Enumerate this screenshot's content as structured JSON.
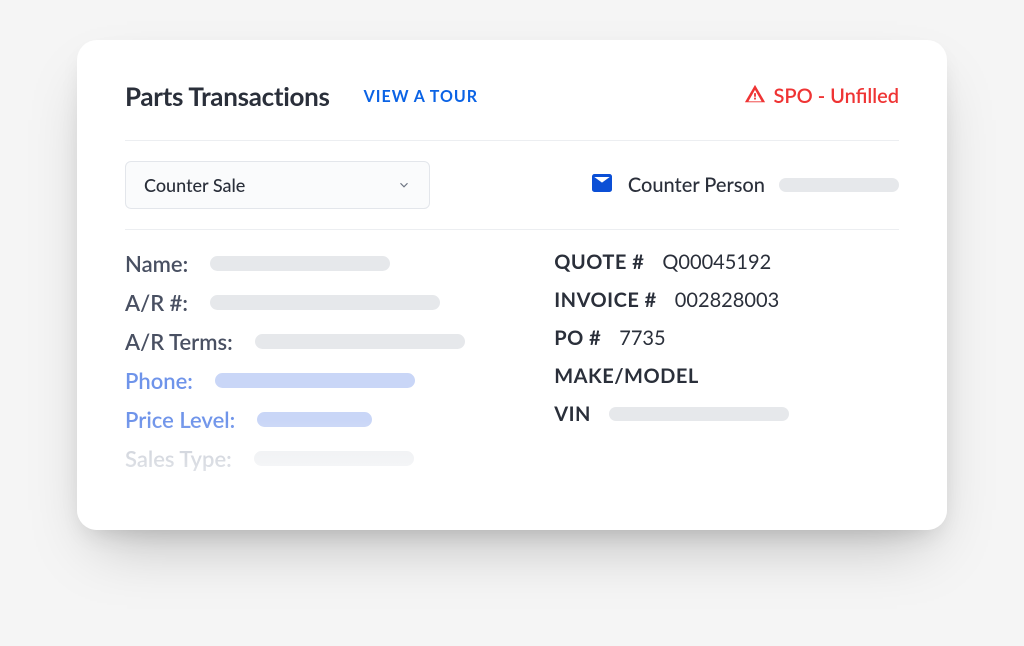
{
  "header": {
    "title": "Parts Transactions",
    "tour_link": "VIEW A TOUR",
    "status_text": "SPO - Unfilled"
  },
  "controls": {
    "transaction_type_selected": "Counter Sale",
    "counter_person_label": "Counter Person"
  },
  "left_fields": {
    "name_label": "Name:",
    "ar_label": "A/R #:",
    "ar_terms_label": "A/R Terms:",
    "phone_label": "Phone:",
    "price_level_label": "Price Level:",
    "sales_type_label": "Sales Type:"
  },
  "right_fields": {
    "quote_label": "QUOTE #",
    "quote_value": "Q00045192",
    "invoice_label": "INVOICE #",
    "invoice_value": "002828003",
    "po_label": "PO #",
    "po_value": "7735",
    "make_model_label": "MAKE/MODEL",
    "vin_label": "VIN"
  }
}
